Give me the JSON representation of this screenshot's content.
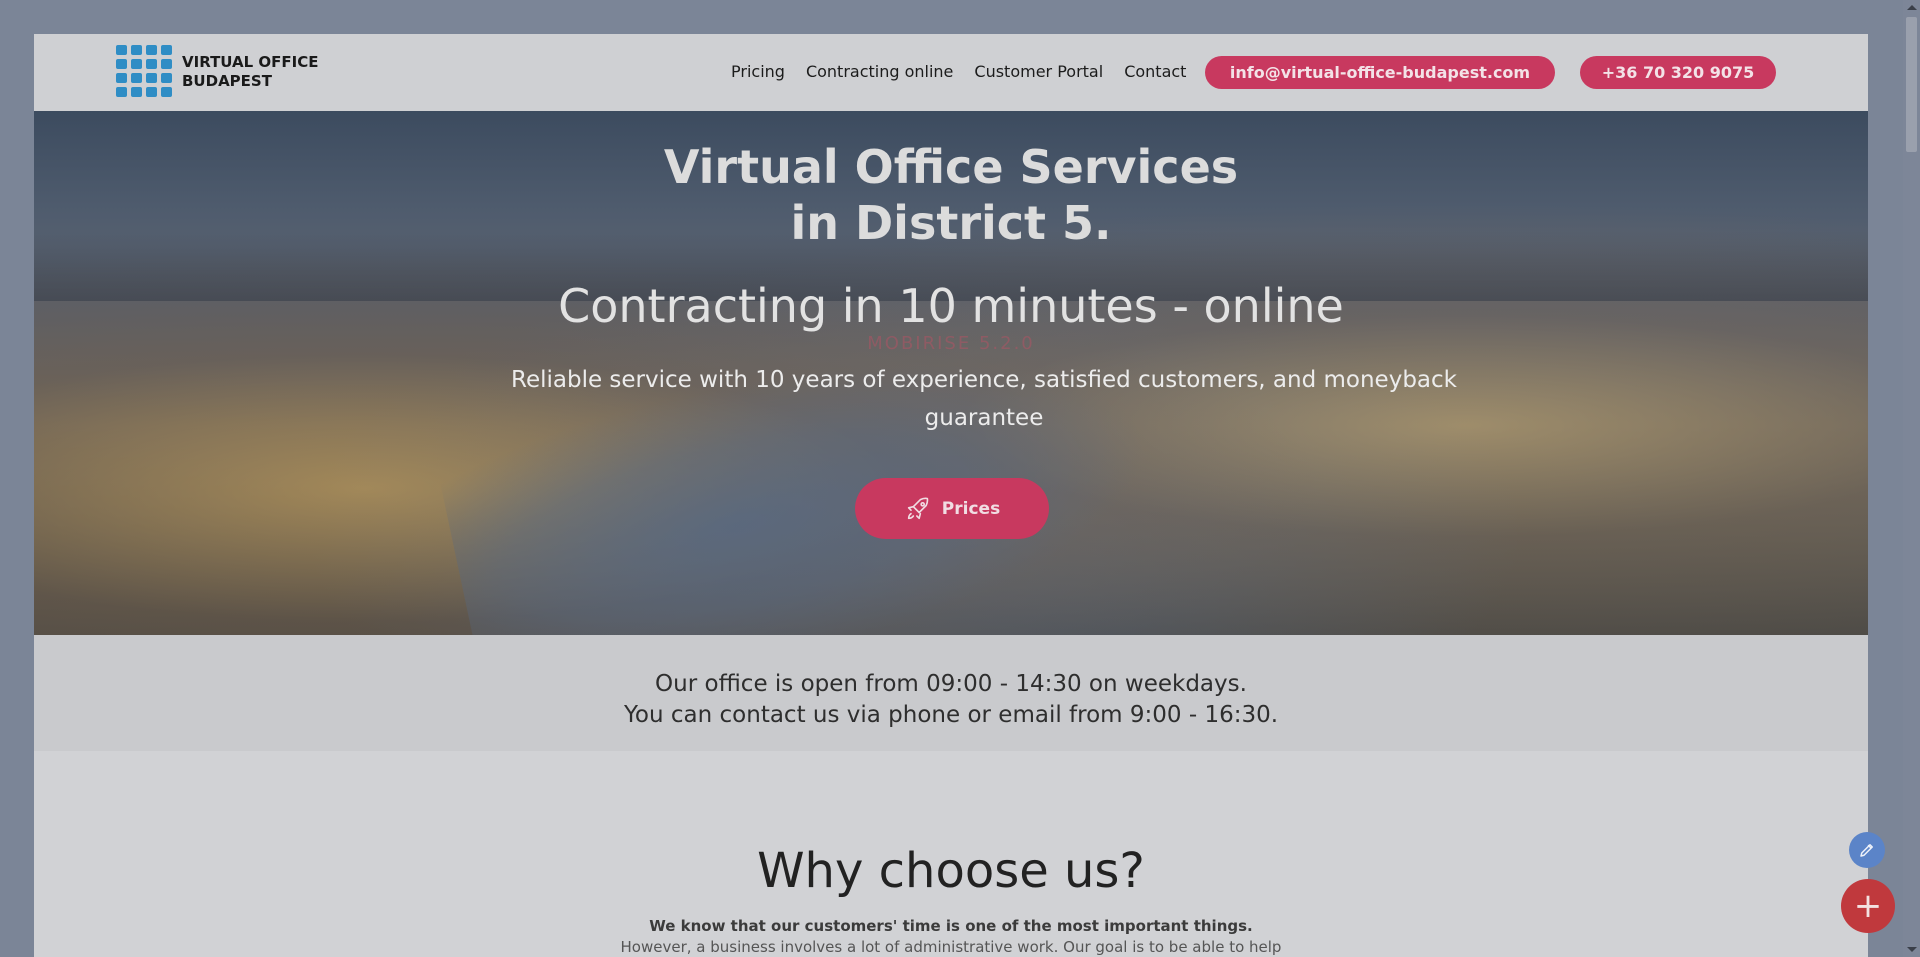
{
  "brand": {
    "line1": "VIRTUAL OFFICE",
    "line2": "BUDAPEST"
  },
  "nav": {
    "items": [
      "Pricing",
      "Contracting online",
      "Customer Portal",
      "Contact"
    ],
    "email": "info@virtual-office-budapest.com",
    "phone": "+36 70 320 9075"
  },
  "hero": {
    "title_line1": "Virtual Office Services",
    "title_line2": "in District 5.",
    "subtitle": "Contracting in 10 minutes - online",
    "watermark": "MOBIRISE 5.2.0",
    "description": "Reliable service with 10 years of experience, satisfied customers, and moneyback guarantee",
    "cta_label": "Prices"
  },
  "hours": {
    "line1": "Our office is open from 09:00 - 14:30 on weekdays.",
    "line2": "You can contact us via phone or email from 9:00 - 16:30."
  },
  "why": {
    "title": "Why choose us?",
    "lead": "We know that our customers' time is one of the most important things.",
    "body": "However, a business involves a lot of administrative work. Our goal is to be able to help our partners with their administration without unnecessary paperwork."
  },
  "fab": {
    "add_symbol": "+"
  },
  "colors": {
    "accent": "#c8395f",
    "logo": "#2f8dc5",
    "fab_edit": "#5b84c8",
    "fab_add": "#c0393d"
  }
}
